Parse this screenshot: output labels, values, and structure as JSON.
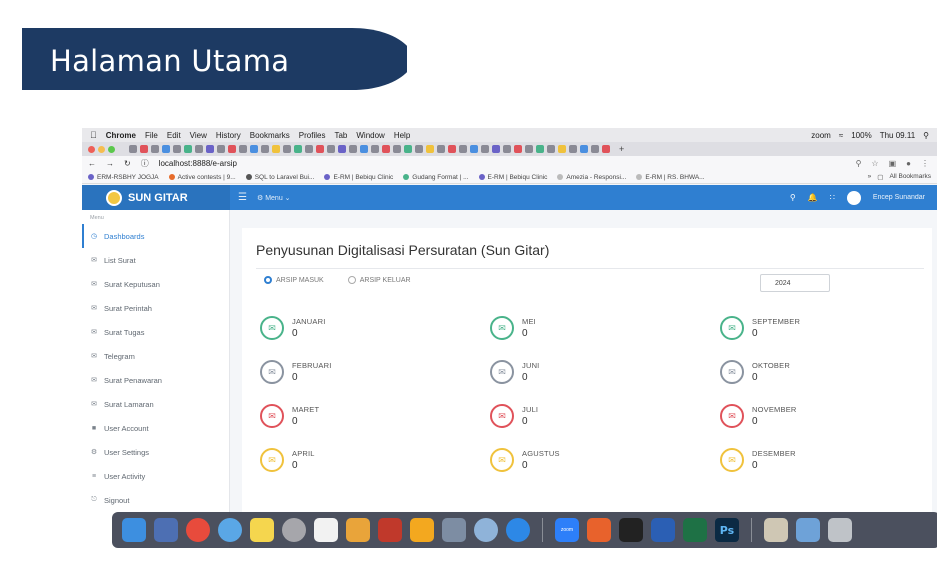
{
  "slide": {
    "title": "Halaman Utama"
  },
  "mac_menubar": {
    "app": "Chrome",
    "items": [
      "File",
      "Edit",
      "View",
      "History",
      "Bookmarks",
      "Profiles",
      "Tab",
      "Window",
      "Help"
    ],
    "zoom": "zoom",
    "battery": "100%",
    "clock": "Thu 09.11"
  },
  "browser": {
    "url": "localhost:8888/e-arsip",
    "bookmarks": [
      "ERM-RSBHY JOGJA",
      "Active contests | 9...",
      "SQL to Laravel Bui...",
      "E-RM | Bebiqu Clinic",
      "Gudang Format | ...",
      "E-RM | Bebiqu Clinic",
      "Amezia - Responsi...",
      "E-RM | RS. BHWA..."
    ],
    "all_bookmarks": "All Bookmarks"
  },
  "navbar": {
    "brand": "SUN GITAR",
    "menu": "Menu",
    "user": "Encep Sunandar"
  },
  "sidebar": {
    "header": "Menu",
    "items": [
      {
        "label": "Dashboards",
        "icon": "dashboard-icon"
      },
      {
        "label": "List Surat",
        "icon": "mail-icon"
      },
      {
        "label": "Surat Keputusan",
        "icon": "mail-icon"
      },
      {
        "label": "Surat Perintah",
        "icon": "mail-icon"
      },
      {
        "label": "Surat Tugas",
        "icon": "mail-icon"
      },
      {
        "label": "Telegram",
        "icon": "mail-icon"
      },
      {
        "label": "Surat Penawaran",
        "icon": "mail-icon"
      },
      {
        "label": "Surat Lamaran",
        "icon": "mail-icon"
      },
      {
        "label": "User Account",
        "icon": "user-icon"
      },
      {
        "label": "User Settings",
        "icon": "gear-icon"
      },
      {
        "label": "User Activity",
        "icon": "activity-icon"
      },
      {
        "label": "Signout",
        "icon": "signout-icon"
      }
    ]
  },
  "main": {
    "title": "Penyusunan Digitalisasi Persuratan (Sun Gitar)",
    "radio_masuk": "ARSIP MASUK",
    "radio_keluar": "ARSIP KELUAR",
    "year": "2024",
    "months": [
      {
        "name": "JANUARI",
        "count": "0",
        "color": "#49b38a"
      },
      {
        "name": "FEBRUARI",
        "count": "0",
        "color": "#8a93a0"
      },
      {
        "name": "MARET",
        "count": "0",
        "color": "#e0525a"
      },
      {
        "name": "APRIL",
        "count": "0",
        "color": "#f0c23c"
      },
      {
        "name": "MEI",
        "count": "0",
        "color": "#49b38a"
      },
      {
        "name": "JUNI",
        "count": "0",
        "color": "#8a93a0"
      },
      {
        "name": "JULI",
        "count": "0",
        "color": "#e0525a"
      },
      {
        "name": "AGUSTUS",
        "count": "0",
        "color": "#f0c23c"
      },
      {
        "name": "SEPTEMBER",
        "count": "0",
        "color": "#49b38a"
      },
      {
        "name": "OKTOBER",
        "count": "0",
        "color": "#8a93a0"
      },
      {
        "name": "NOVEMBER",
        "count": "0",
        "color": "#e0525a"
      },
      {
        "name": "DESEMBER",
        "count": "0",
        "color": "#f0c23c"
      }
    ]
  },
  "dock": {
    "zoom_label": "zoom",
    "ps_label": "Ps"
  }
}
